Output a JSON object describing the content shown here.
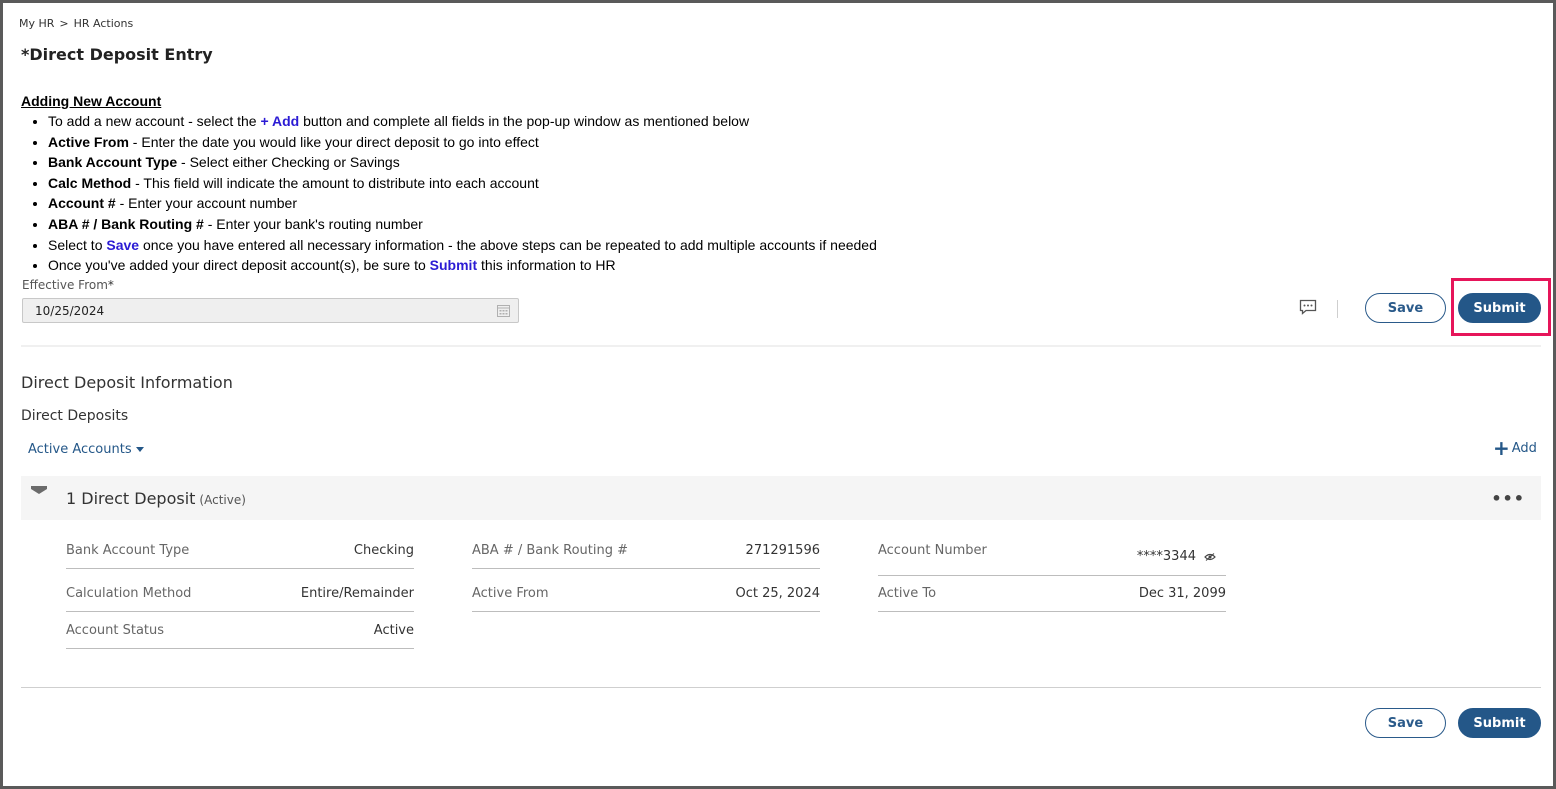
{
  "breadcrumb": {
    "home": "My HR",
    "separator": ">",
    "current": "HR Actions"
  },
  "page_title": "*Direct Deposit Entry",
  "instructions": {
    "heading": "Adding New Account",
    "items": [
      {
        "pre": "To add a new account - select the ",
        "strong": "",
        "blue": "+ Add",
        "post": " button and complete all fields in the pop-up window as mentioned below"
      },
      {
        "pre": "",
        "strong": "Active From",
        "blue": "",
        "post": " - Enter the date you would like your direct deposit to go into effect"
      },
      {
        "pre": "",
        "strong": "Bank Account Type",
        "blue": "",
        "post": " - Select either Checking or Savings"
      },
      {
        "pre": "",
        "strong": "Calc Method",
        "blue": "",
        "post": " - This field will indicate the amount to distribute into each account"
      },
      {
        "pre": "",
        "strong": "Account #",
        "blue": "",
        "post": " - Enter your account number"
      },
      {
        "pre": "",
        "strong": "ABA # / Bank Routing #",
        "blue": "",
        "post": " - Enter your bank's routing number"
      },
      {
        "pre": "Select to ",
        "strong": "",
        "blue": "Save",
        "post": " once you have entered all necessary information - the above steps can be repeated to add multiple accounts if needed"
      },
      {
        "pre": "Once you've added your direct deposit account(s), be sure to ",
        "strong": "",
        "blue": "Submit",
        "post": " this information to HR"
      }
    ]
  },
  "effective_from": {
    "label": "Effective From",
    "required_mark": "*",
    "value": "10/25/2024"
  },
  "toolbar": {
    "save_label": "Save",
    "submit_label": "Submit"
  },
  "section": {
    "title": "Direct Deposit Information",
    "subtitle": "Direct Deposits",
    "filter_label": "Active Accounts",
    "add_label": "Add"
  },
  "deposit": {
    "title": "1 Direct Deposit",
    "status": "(Active)",
    "fields": {
      "bank_account_type": {
        "label": "Bank Account Type",
        "value": "Checking"
      },
      "calculation_method": {
        "label": "Calculation Method",
        "value": "Entire/Remainder"
      },
      "account_status": {
        "label": "Account Status",
        "value": "Active"
      },
      "routing": {
        "label": "ABA # / Bank Routing #",
        "value": "271291596"
      },
      "active_from": {
        "label": "Active From",
        "value": "Oct 25, 2024"
      },
      "account_number": {
        "label": "Account Number",
        "value": "****3344"
      },
      "active_to": {
        "label": "Active To",
        "value": "Dec 31, 2099"
      }
    }
  },
  "footer": {
    "save_label": "Save",
    "submit_label": "Submit"
  },
  "colors": {
    "primary": "#245788",
    "highlight": "#e6155a",
    "instruction_blue": "#2b1bd4"
  }
}
